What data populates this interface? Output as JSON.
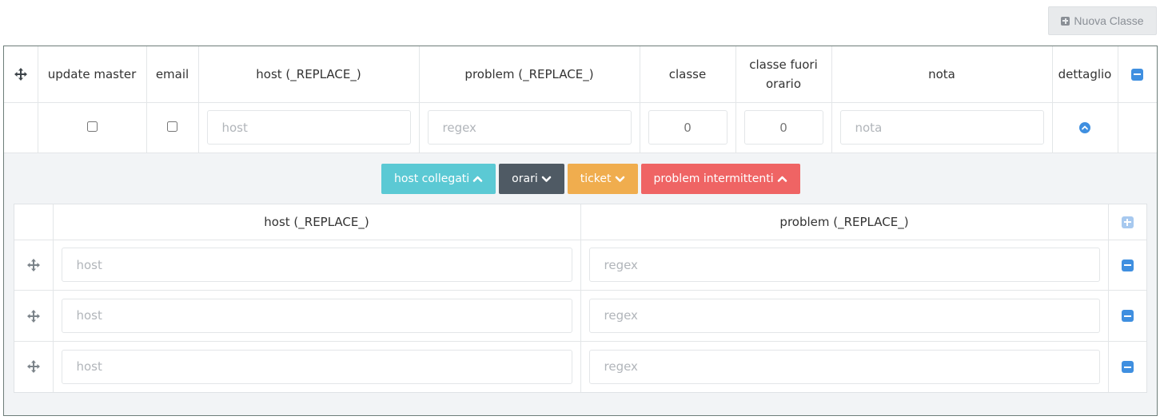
{
  "toolbar": {
    "new_class_label": "Nuova Classe"
  },
  "main_table": {
    "headers": {
      "update_master": "update master",
      "email": "email",
      "host": "host (_REPLACE_)",
      "problem": "problem (_REPLACE_)",
      "classe": "classe",
      "classe_fuori_orario": "classe fuori orario",
      "nota": "nota",
      "dettaglio": "dettaglio"
    },
    "row": {
      "update_master_checked": false,
      "email_checked": false,
      "host_placeholder": "host",
      "problem_placeholder": "regex",
      "classe_placeholder": "0",
      "classe_fuori_orario_placeholder": "0",
      "nota_placeholder": "nota"
    }
  },
  "detail": {
    "buttons": {
      "host_collegati": "host collegati",
      "orari": "orari",
      "ticket": "ticket",
      "problem_intermittenti": "problem intermittenti"
    },
    "colors": {
      "cyan": "#5bc9d4",
      "dark": "#4f5a64",
      "orange": "#f0ad4e",
      "red": "#ef6464",
      "blue": "#3f8fe0"
    },
    "host_table": {
      "headers": {
        "host": "host (_REPLACE_)",
        "problem": "problem (_REPLACE_)"
      },
      "rows": [
        {
          "host_placeholder": "host",
          "problem_placeholder": "regex"
        },
        {
          "host_placeholder": "host",
          "problem_placeholder": "regex"
        },
        {
          "host_placeholder": "host",
          "problem_placeholder": "regex"
        }
      ]
    }
  },
  "icons": {
    "move": "move-icon",
    "remove": "minus-square-icon",
    "add": "plus-square-icon",
    "collapse": "chevron-circle-up-icon"
  }
}
